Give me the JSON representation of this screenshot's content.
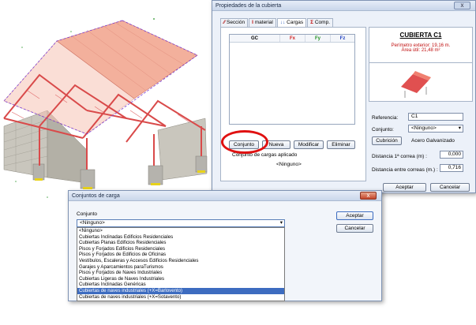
{
  "props_window": {
    "title": "Propiedades de la cubierta",
    "close": "x",
    "tabs": [
      "Sección",
      "material",
      "Cargas",
      "Comp."
    ],
    "grid_headers": [
      "GC",
      "Fx",
      "Fy",
      "Fz"
    ],
    "cover": {
      "title": "CUBIERTA C1",
      "perimeter": "Perímetro exterior: 19,16 m.",
      "area": "Área útil: 21,48 m²"
    },
    "buttons": {
      "conjunto": "Conjunto",
      "nueva": "Nueva",
      "modificar": "Modificar",
      "eliminar": "Eliminar",
      "cubricion": "Cubrición",
      "aceptar": "Aceptar",
      "cancelar": "Cancelar"
    },
    "applied_label": "Conjunto de cargas aplicado",
    "applied_value": "<Ninguno>",
    "referencia_label": "Referencia:",
    "referencia_value": "C1",
    "conjunto_label": "Conjunto:",
    "conjunto_value": "<Ninguno>",
    "material_value": "Acero Galvanizado",
    "dist1_label": "Distancia 1ª correa (m) :",
    "dist1_value": "0,000",
    "dist2_label": "Distancia entre correas (m.) :",
    "dist2_value": "0,716"
  },
  "loads_window": {
    "title": "Conjuntos de carga",
    "close": "x",
    "conjunto_label": "Conjunto",
    "selected": "<Ninguno>",
    "aceptar": "Aceptar",
    "cancelar": "Cancelar",
    "options": [
      "<Ninguno>",
      "Cubiertas Inclinadas Edificios Residenciales",
      "Cubiertas Planas Edificios Residenciales",
      "Pisos y Forjados Edificios Residenciales",
      "Pisos y Forjados de Edificios de Oficinas",
      "Vestíbulos, Escaleras y Accesos Edificios Residenciales",
      "Garajes y Aparcamientos paraTurismos",
      "Pisos y Forjados de Naves Industriales",
      "Cubiertas Ligeras de Naves Industriales",
      "Cubiertas Inclinadas Genéricas",
      "Cubiertas de naves industriales (+X=Barlovento)",
      "Cubiertas de naves industriales (+X=Sotavento)"
    ],
    "highlighted_index": 10
  },
  "colors": {
    "roof": "#f4a08a",
    "frame": "#d94a4a",
    "annotation": "#e01010",
    "selection": "#3d6cc0",
    "cover_title": "#c01010"
  }
}
